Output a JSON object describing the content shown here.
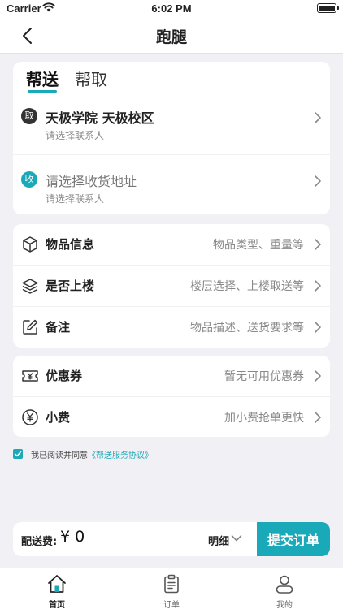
{
  "status_bar": {
    "carrier": "Carrier",
    "time": "6:02 PM"
  },
  "nav": {
    "title": "跑腿"
  },
  "tabs": [
    {
      "label": "帮送"
    },
    {
      "label": "帮取"
    }
  ],
  "pickup": {
    "badge": "取",
    "address": "天极学院 天极校区",
    "contact": "请选择联系人"
  },
  "delivery": {
    "badge": "收",
    "address": "请选择收货地址",
    "contact": "请选择联系人"
  },
  "details": [
    {
      "label": "物品信息",
      "hint": "物品类型、重量等",
      "icon": "box-icon"
    },
    {
      "label": "是否上楼",
      "hint": "楼层选择、上楼取送等",
      "icon": "layers-icon"
    },
    {
      "label": "备注",
      "hint": "物品描述、送货要求等",
      "icon": "edit-icon"
    }
  ],
  "extras": [
    {
      "label": "优惠券",
      "hint": "暂无可用优惠券",
      "icon": "coupon-icon"
    },
    {
      "label": "小费",
      "hint": "加小费抢单更快",
      "icon": "yuan-icon"
    }
  ],
  "agreement": {
    "prefix": "我已阅读并同意",
    "link": "《帮送服务协议》",
    "checked": true
  },
  "fee": {
    "label": "配送费:",
    "amount": "¥ 0",
    "detail": "明细",
    "submit": "提交订单"
  },
  "tabbar": [
    {
      "label": "首页",
      "icon": "home-icon",
      "active": true
    },
    {
      "label": "订单",
      "icon": "clipboard-icon",
      "active": false
    },
    {
      "label": "我的",
      "icon": "user-icon",
      "active": false
    }
  ],
  "colors": {
    "accent": "#19a9b8",
    "background": "#f0f0f5",
    "dark_badge": "#333333"
  }
}
